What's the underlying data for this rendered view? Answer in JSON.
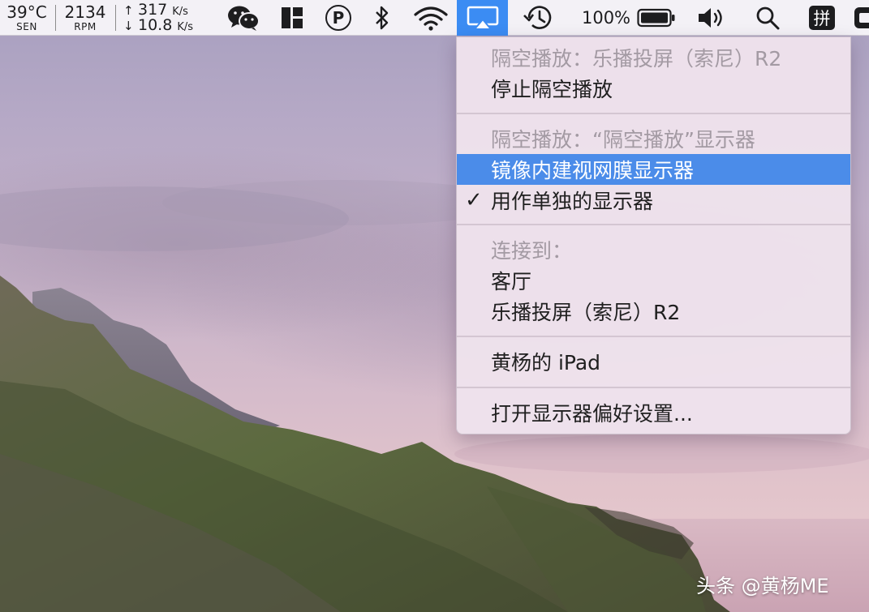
{
  "menubar": {
    "temperature": {
      "value": "39°C",
      "label": "SEN"
    },
    "fan": {
      "value": "2134",
      "label": "RPM"
    },
    "network": {
      "up_arrow": "↑",
      "up_value": "317",
      "up_unit": "K/s",
      "down_arrow": "↓",
      "down_value": "10.8",
      "down_unit": "K/s"
    },
    "parking_symbol": "P",
    "battery_percent": "100%",
    "ime_label": "拼"
  },
  "airplay_menu": {
    "items": [
      {
        "label": "隔空播放：乐播投屏（索尼）R2",
        "state": "disabled"
      },
      {
        "label": "停止隔空播放",
        "state": "normal"
      },
      {
        "label": "隔空播放：“隔空播放”显示器",
        "state": "disabled"
      },
      {
        "label": "镜像内建视网膜显示器",
        "state": "selected"
      },
      {
        "label": "用作单独的显示器",
        "state": "checked",
        "check_mark": "✓"
      },
      {
        "label": "连接到：",
        "state": "disabled"
      },
      {
        "label": "客厅",
        "state": "normal"
      },
      {
        "label": "乐播投屏（索尼）R2",
        "state": "normal"
      },
      {
        "label": "黄杨的 iPad",
        "state": "normal"
      },
      {
        "label": "打开显示器偏好设置...",
        "state": "normal"
      }
    ]
  },
  "watermark": "头条 @黄杨ME",
  "colors": {
    "menubar_bg": "#f3f1f6",
    "airplay_active": "#3b8cf3",
    "menu_selected": "#4b8ce9",
    "menu_disabled_text": "#a39aa3"
  }
}
